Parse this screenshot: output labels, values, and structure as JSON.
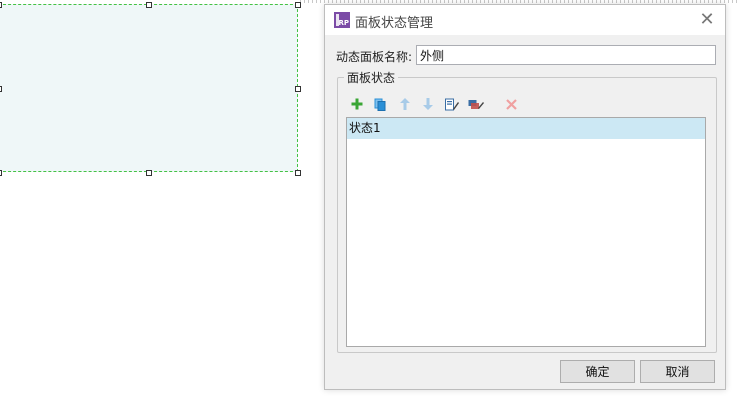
{
  "dialog": {
    "title": "面板状态管理",
    "app_logo_text": "RP",
    "close_glyph": "✕",
    "name_label": "动态面板名称:",
    "name_value": "外侧",
    "group_label": "面板状态",
    "toolbar": [
      {
        "icon": "add-icon",
        "color": "#3aa635",
        "enabled": true
      },
      {
        "icon": "duplicate-icon",
        "color": "#2a8fd6",
        "enabled": true
      },
      {
        "icon": "move-up-icon",
        "color": "#a8cbe8",
        "enabled": false
      },
      {
        "icon": "move-down-icon",
        "color": "#a8cbe8",
        "enabled": false
      },
      {
        "icon": "edit-state-icon",
        "color": "#3a6ea5",
        "enabled": true
      },
      {
        "icon": "edit-all-states-icon",
        "color": "#c0504d",
        "enabled": true
      },
      {
        "icon": "delete-icon",
        "color": "#f0a0a0",
        "enabled": false
      }
    ],
    "states": [
      "状态1"
    ],
    "ok_label": "确定",
    "cancel_label": "取消"
  },
  "colors": {
    "selection": "#cce8f4",
    "panel_fill": "#eff7f8",
    "panel_border": "#44c244",
    "logo": "#7b4ba6"
  }
}
